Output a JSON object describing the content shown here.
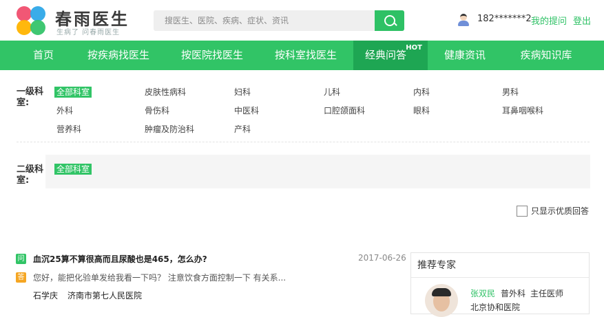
{
  "header": {
    "brand": "春雨医生",
    "slogan": "生病了 问春雨医生",
    "search_placeholder": "搜医生、医院、疾病、症状、资讯",
    "user_phone": "182*******2",
    "my_questions": "我的提问",
    "logout": "登出"
  },
  "nav": {
    "items": [
      {
        "label": "首页"
      },
      {
        "label": "按疾病找医生"
      },
      {
        "label": "按医院找医生"
      },
      {
        "label": "按科室找医生"
      },
      {
        "label": "经典问答",
        "badge": "HOT",
        "active": true
      },
      {
        "label": "健康资讯"
      },
      {
        "label": "疾病知识库"
      }
    ]
  },
  "filter": {
    "level1_label": "一级科室:",
    "level1": [
      "全部科室",
      "皮肤性病科",
      "妇科",
      "儿科",
      "内科",
      "男科",
      "外科",
      "骨伤科",
      "中医科",
      "口腔颌面科",
      "眼科",
      "耳鼻咽喉科",
      "营养科",
      "肿瘤及防治科",
      "产科"
    ],
    "level1_selected": "全部科室",
    "level2_label": "二级科室:",
    "level2": [
      "全部科室"
    ],
    "quality_only": "只显示优质回答"
  },
  "question": {
    "q_badge": "问",
    "a_badge": "答",
    "title": "血沉25算不算很高而且尿酸也是465，怎么办?",
    "date": "2017-06-26",
    "answer": "您好，能把化验单发给我看一下吗？ 注意饮食方面控制一下 有关系...",
    "doctor": "石学庆",
    "hospital": "济南市第七人民医院"
  },
  "experts": {
    "title": "推荐专家",
    "items": [
      {
        "name": "张双民",
        "dept": "普外科",
        "title": "主任医师",
        "hospital": "北京协和医院"
      }
    ]
  },
  "colors": {
    "primary": "#31c466",
    "active_nav": "#1ea653",
    "answer_badge": "#f5a623"
  }
}
